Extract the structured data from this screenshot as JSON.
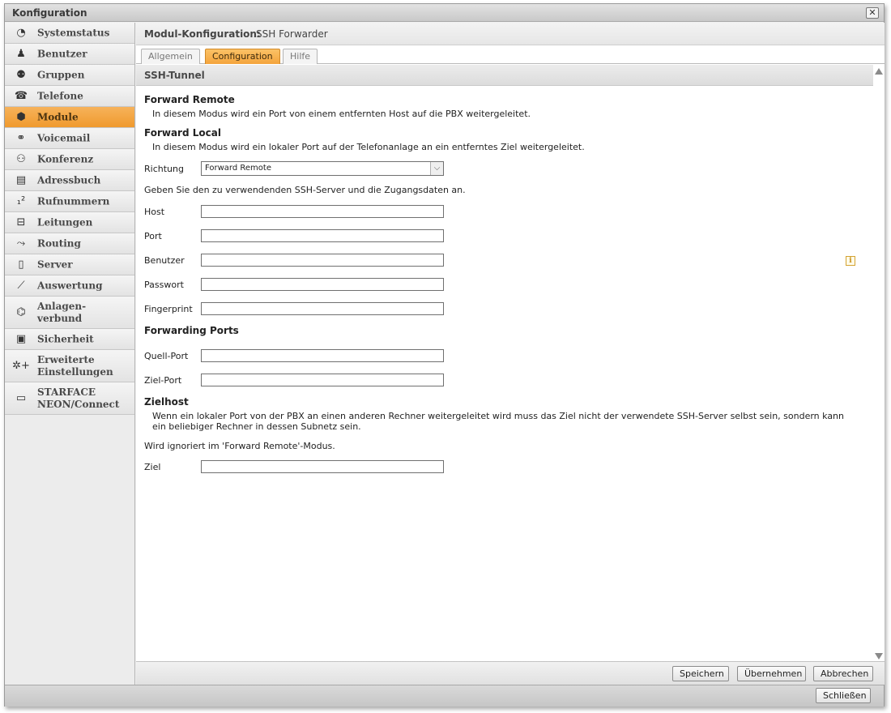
{
  "window": {
    "title": "Konfiguration",
    "close_glyph": "✕"
  },
  "sidebar": {
    "items": [
      {
        "label": "Systemstatus",
        "icon": "◔"
      },
      {
        "label": "Benutzer",
        "icon": "♟"
      },
      {
        "label": "Gruppen",
        "icon": "⚉"
      },
      {
        "label": "Telefone",
        "icon": "☎"
      },
      {
        "label": "Module",
        "icon": "⬢"
      },
      {
        "label": "Voicemail",
        "icon": "⚭"
      },
      {
        "label": "Konferenz",
        "icon": "⚇"
      },
      {
        "label": "Adressbuch",
        "icon": "▤"
      },
      {
        "label": "Rufnummern",
        "icon": "₁²"
      },
      {
        "label": "Leitungen",
        "icon": "⊟"
      },
      {
        "label": "Routing",
        "icon": "⤳"
      },
      {
        "label": "Server",
        "icon": "▯"
      },
      {
        "label": "Auswertung",
        "icon": "⟋"
      },
      {
        "label1": "Anlagen-",
        "label2": "verbund",
        "icon": "⌬"
      },
      {
        "label": "Sicherheit",
        "icon": "▣"
      },
      {
        "label1": "Erweiterte",
        "label2": "Einstellungen",
        "icon": "✲+"
      },
      {
        "label1": "STARFACE",
        "label2": "NEON/Connect",
        "icon": "▭"
      }
    ]
  },
  "module": {
    "label": "Modul-Konfiguration:",
    "name": "SSH Forwarder"
  },
  "tabs": [
    "Allgemein",
    "Configuration",
    "Hilfe"
  ],
  "section": {
    "title": "SSH-Tunnel"
  },
  "form": {
    "forward_remote_heading": "Forward Remote",
    "forward_remote_desc": "In diesem Modus wird ein Port von einem entfernten Host auf die PBX weitergeleitet.",
    "forward_local_heading": "Forward Local",
    "forward_local_desc": "In diesem Modus wird ein lokaler Port auf der Telefonanlage an ein entferntes Ziel weitergeleitet.",
    "richtung_label": "Richtung",
    "richtung_value": "Forward Remote",
    "ssh_hint": "Geben Sie den zu verwendenden SSH-Server und die Zugangsdaten an.",
    "host_label": "Host",
    "port_label": "Port",
    "benutzer_label": "Benutzer",
    "passwort_label": "Passwort",
    "fingerprint_label": "Fingerprint",
    "forwarding_ports_heading": "Forwarding Ports",
    "quell_port_label": "Quell-Port",
    "ziel_port_label": "Ziel-Port",
    "zielhost_heading": "Zielhost",
    "zielhost_desc1": "Wenn ein lokaler Port von der PBX an einen anderen Rechner weitergeleitet wird muss das Ziel nicht der verwendete SSH-Server selbst sein, sondern kann",
    "zielhost_desc2": "ein beliebiger Rechner in dessen Subnetz sein.",
    "ignored_hint": "Wird ignoriert im 'Forward Remote'-Modus.",
    "ziel_label": "Ziel",
    "info_glyph": "i"
  },
  "footer": {
    "save": "Speichern",
    "apply": "Übernehmen",
    "cancel": "Abbrechen"
  },
  "bottom": {
    "close": "Schließen"
  }
}
